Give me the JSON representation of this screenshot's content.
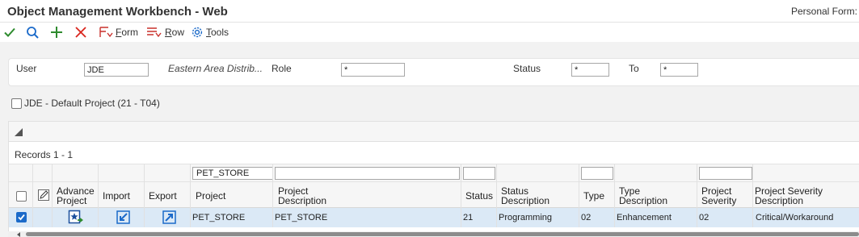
{
  "window": {
    "title": "Object Management Workbench - Web",
    "personal_form": "Personal Form:"
  },
  "toolbar": {
    "ok_icon": "checkmark-icon",
    "find_icon": "search-icon",
    "add_icon": "plus-icon",
    "close_icon": "close-x-icon",
    "form_menu": "orm",
    "form_menu_accel": "F",
    "row_menu": "ow",
    "row_menu_accel": "R",
    "tools_menu": "ools",
    "tools_menu_accel": "T"
  },
  "criteria": {
    "user_label": "User",
    "user_value": "JDE",
    "user_description": "Eastern Area Distrib...",
    "role_label": "Role",
    "role_value": "*",
    "status_label": "Status",
    "status_value": "*",
    "to_label": "To",
    "to_value": "*"
  },
  "default_project": {
    "label": "JDE - Default Project (21 - T04)",
    "checked": false
  },
  "grid": {
    "records_label": "Records 1 - 1",
    "filters": {
      "project": "PET_STORE",
      "project_description": "",
      "status": "",
      "type": "",
      "project_severity": ""
    },
    "columns": {
      "advance_project": [
        "Advance",
        "Project"
      ],
      "import": "Import",
      "export": "Export",
      "project": "Project",
      "project_description": [
        "Project",
        "Description"
      ],
      "status": "Status",
      "status_description": [
        "Status",
        "Description"
      ],
      "type": "Type",
      "type_description": [
        "Type",
        "Description"
      ],
      "project_severity": [
        "Project",
        "Severity"
      ],
      "project_severity_description": [
        "Project Severity",
        "Description"
      ]
    },
    "rows": [
      {
        "selected": true,
        "project": "PET_STORE",
        "project_description": "PET_STORE",
        "status": "21",
        "status_description": "Programming",
        "type": "02",
        "type_description": "Enhancement",
        "project_severity": "02",
        "project_severity_description": "Critical/Workaround"
      }
    ]
  },
  "colors": {
    "accent_blue": "#1b6ac9",
    "ok_green": "#2e8b2e",
    "cancel_red": "#d9251d",
    "selected_row": "#dbe9f6"
  }
}
